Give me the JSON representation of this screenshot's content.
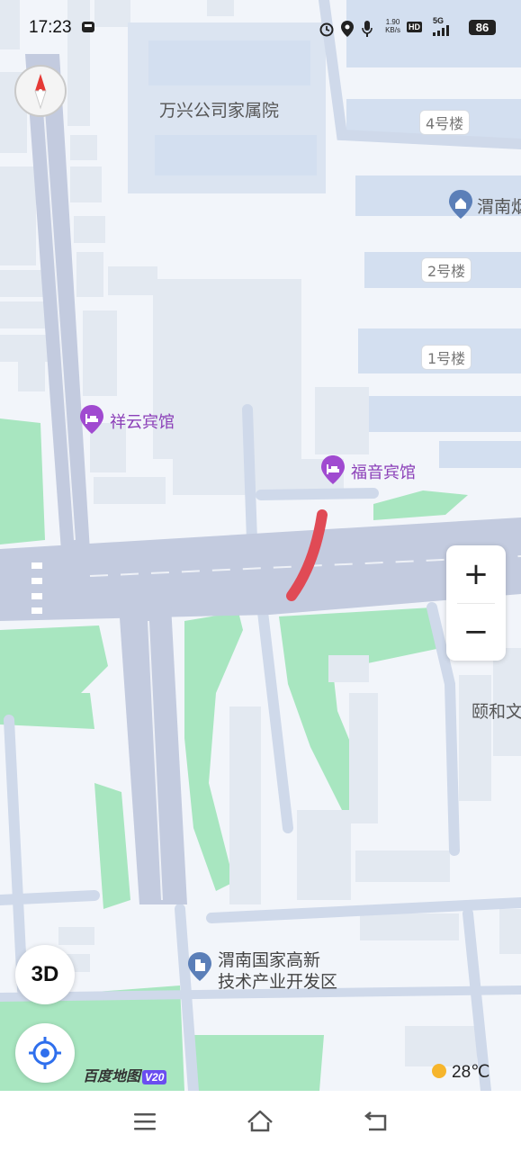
{
  "status_bar": {
    "time": "17:23",
    "net_speed_value": "1.90",
    "net_speed_unit": "KB/s",
    "hd_label": "HD",
    "network_label": "5G",
    "battery": "86"
  },
  "map": {
    "area_labels": {
      "wanxing": "万兴公司家属院",
      "weinan_partial": "渭南烟",
      "yihe_partial": "颐和文",
      "park_line1": "渭南国家高新",
      "park_line2": "技术产业开发区"
    },
    "buildings": {
      "b4": "4号楼",
      "b2": "2号楼",
      "b1": "1号楼"
    },
    "pois": {
      "xiangyun": "祥云宾馆",
      "fuyin": "福音宾馆"
    },
    "route_color": "#e04a55",
    "poi_color": "#8b3fb8"
  },
  "controls": {
    "zoom_in": "+",
    "zoom_out": "−",
    "view_3d": "3D",
    "locate_icon": "locate-icon",
    "compass_icon": "compass-icon"
  },
  "logo": {
    "name": "百度地图",
    "version": "V20"
  },
  "weather": {
    "temperature": "28℃"
  },
  "nav": {
    "menu_icon": "menu-icon",
    "home_icon": "home-icon",
    "back_icon": "back-icon"
  }
}
